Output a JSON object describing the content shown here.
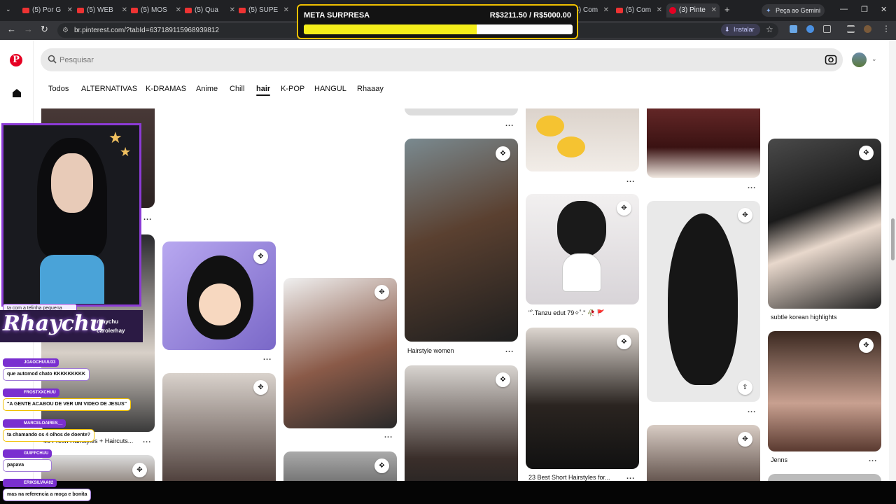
{
  "browser": {
    "tabs": [
      {
        "title": "(5) Por G"
      },
      {
        "title": "(5) WEB"
      },
      {
        "title": "(5) MOS"
      },
      {
        "title": "(5) Qua"
      },
      {
        "title": "(5) SUPE"
      },
      {
        "title": "(5) Com"
      },
      {
        "title": "(5) Com"
      },
      {
        "title": "(3) Pinte"
      }
    ],
    "gemini_label": "Peça ao Gemini",
    "url": "br.pinterest.com/?tabId=637189115968939812",
    "install_label": "Instalar"
  },
  "goal": {
    "label": "META SURPRESA",
    "amount": "R$3211.50 / R$5000.00",
    "progress_fraction": 0.6423,
    "bar_color": "#f5ee1a"
  },
  "pinterest": {
    "search_placeholder": "Pesquisar",
    "categories": [
      "Todos",
      "ALTERNATIVAS",
      "K-DRAMAS",
      "Anime",
      "Chill",
      "hair",
      "K-POP",
      "HANGUL",
      "Rhaaay"
    ],
    "active_category": "hair",
    "brand_color": "#e60023",
    "pins": [
      {
        "caption": "46 Fresh Hairstyles + Haircuts..."
      },
      {
        "caption": "Hairstyle women"
      },
      {
        "caption": "\"˚.Tanzu edut 79✧˚.\" 🥀 🚩"
      },
      {
        "caption": "23 Best Short Hairstyles for..."
      },
      {
        "caption": "subtle korean highlights"
      },
      {
        "caption": "Jenns"
      }
    ]
  },
  "stream": {
    "streamer_name": "Rhaychu",
    "handles": [
      "rhaychu",
      "carolerhay"
    ],
    "chat_preview": "ta com a telinha pequena",
    "chat": [
      {
        "user": "JOAOCHUUU33",
        "message": "que automod chato KKKKKKKKK",
        "gold": false
      },
      {
        "user": "FROSTXXCHUU",
        "message": "\"A GENTE ACABOU DE VER UM VIDEO DE JESUS\"",
        "gold": true
      },
      {
        "user": "MARCELOAIRES__",
        "message": "ta chamando os 4 olhos de doente?",
        "gold": true
      },
      {
        "user": "GUIFFCHUU",
        "message": "papava",
        "gold": false
      },
      {
        "user": "ERIKSILVAA02",
        "message": "mas na referencia a moça e bonita",
        "gold": false
      }
    ]
  }
}
